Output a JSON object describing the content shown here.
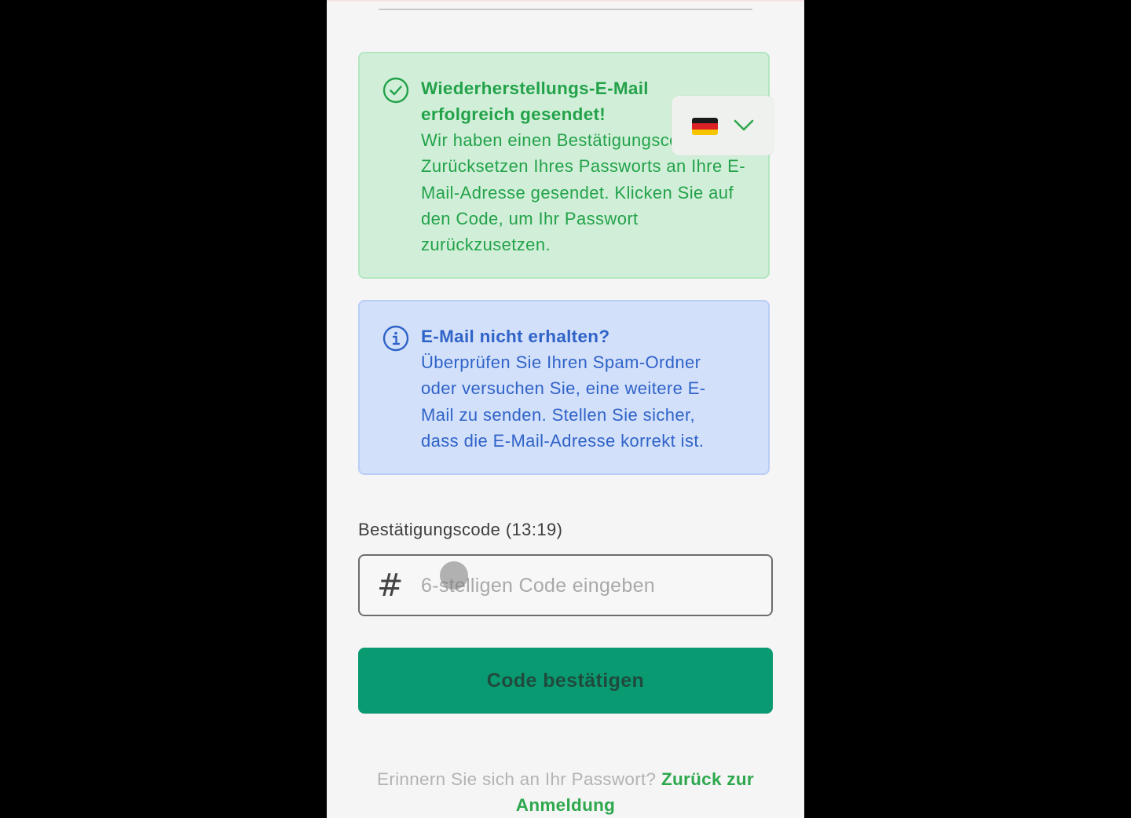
{
  "colors": {
    "success_text": "#23a24a",
    "success_bg": "#d1efd8",
    "info_text": "#2f63c8",
    "info_bg": "#d3e0fa",
    "primary_button": "#0a9a72",
    "link": "#2ea84d"
  },
  "language": {
    "selected_flag": "germany-flag-icon",
    "toggle_icon": "chevron-down-icon"
  },
  "success_alert": {
    "icon": "check-circle-icon",
    "title": "Wiederherstellungs-E-Mail erfolgreich gesendet!",
    "message": "Wir haben einen Bestätigungscode zum Zurücksetzen Ihres Passworts an Ihre E-Mail-Adresse gesendet. Klicken Sie auf den Code, um Ihr Passwort zurückzusetzen."
  },
  "info_alert": {
    "icon": "info-circle-icon",
    "title": "E-Mail nicht erhalten?",
    "message": "Überprüfen Sie Ihren Spam-Ordner oder versuchen Sie, eine weitere E-Mail zu senden. Stellen Sie sicher, dass die E-Mail-Adresse korrekt ist."
  },
  "code_field": {
    "label": "Bestätigungscode (13:19)",
    "icon": "hash-icon",
    "icon_glyph": "#",
    "value": "",
    "placeholder": "6-stelligen Code eingeben"
  },
  "submit": {
    "label": "Code bestätigen"
  },
  "footer": {
    "prompt": "Erinnern Sie sich an Ihr Passwort?",
    "link_label": "Zurück zur Anmeldung"
  }
}
